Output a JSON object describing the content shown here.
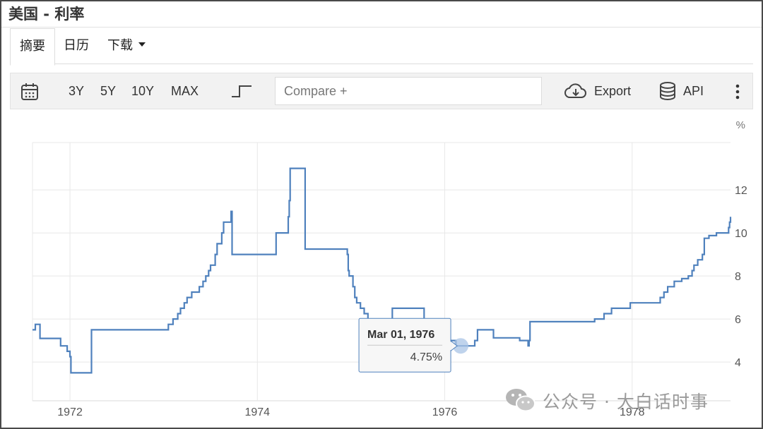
{
  "page": {
    "title": "美国 - 利率"
  },
  "tabs": [
    {
      "label": "摘要",
      "active": true
    },
    {
      "label": "日历",
      "active": false
    },
    {
      "label": "下载",
      "active": false
    }
  ],
  "toolbar": {
    "ranges": [
      "3Y",
      "5Y",
      "10Y",
      "MAX"
    ],
    "compare_placeholder": "Compare +",
    "export_label": "Export",
    "api_label": "API"
  },
  "tooltip": {
    "date": "Mar 01, 1976",
    "value": "4.75%"
  },
  "watermark": {
    "text": "公众号 · 大白话时事"
  },
  "colors": {
    "line": "#4f81bd",
    "grid": "#e8e8e8",
    "axis_text": "#555555",
    "tooltip_border": "#4f81bd"
  },
  "chart_data": {
    "type": "line",
    "step": true,
    "unit": "%",
    "x_tick_labels": [
      "1972",
      "1974",
      "1976",
      "1978"
    ],
    "x_ticks": [
      1972.0,
      1974.0,
      1976.0,
      1978.0
    ],
    "y_ticks": [
      4,
      6,
      8,
      10,
      12
    ],
    "xlim": [
      1971.6,
      1979.05
    ],
    "ylim": [
      2.2,
      14.2
    ],
    "grid": true,
    "highlight": {
      "x": 1976.17,
      "y": 4.75
    },
    "series": [
      {
        "values": [
          [
            1971.6,
            5.5
          ],
          [
            1971.63,
            5.75
          ],
          [
            1971.67,
            5.75
          ],
          [
            1971.68,
            5.1
          ],
          [
            1971.88,
            5.1
          ],
          [
            1971.9,
            4.75
          ],
          [
            1971.95,
            4.75
          ],
          [
            1971.97,
            4.5
          ],
          [
            1971.99,
            4.5
          ],
          [
            1972.0,
            4.25
          ],
          [
            1972.01,
            3.5
          ],
          [
            1972.22,
            3.5
          ],
          [
            1972.23,
            5.5
          ],
          [
            1973.02,
            5.5
          ],
          [
            1973.05,
            5.75
          ],
          [
            1973.1,
            6.0
          ],
          [
            1973.15,
            6.25
          ],
          [
            1973.18,
            6.5
          ],
          [
            1973.22,
            6.75
          ],
          [
            1973.25,
            7.0
          ],
          [
            1973.3,
            7.25
          ],
          [
            1973.38,
            7.5
          ],
          [
            1973.42,
            7.75
          ],
          [
            1973.45,
            8.0
          ],
          [
            1973.48,
            8.25
          ],
          [
            1973.5,
            8.5
          ],
          [
            1973.55,
            9.0
          ],
          [
            1973.57,
            9.5
          ],
          [
            1973.62,
            10.0
          ],
          [
            1973.64,
            10.5
          ],
          [
            1973.7,
            10.5
          ],
          [
            1973.72,
            11.0
          ],
          [
            1973.73,
            9.0
          ],
          [
            1974.17,
            9.0
          ],
          [
            1974.2,
            10.0
          ],
          [
            1974.32,
            10.0
          ],
          [
            1974.33,
            10.75
          ],
          [
            1974.34,
            11.5
          ],
          [
            1974.35,
            13.0
          ],
          [
            1974.5,
            13.0
          ],
          [
            1974.51,
            9.25
          ],
          [
            1974.94,
            9.25
          ],
          [
            1974.96,
            9.0
          ],
          [
            1974.97,
            8.25
          ],
          [
            1974.98,
            8.0
          ],
          [
            1975.02,
            7.5
          ],
          [
            1975.04,
            7.0
          ],
          [
            1975.06,
            6.75
          ],
          [
            1975.1,
            6.5
          ],
          [
            1975.14,
            6.25
          ],
          [
            1975.18,
            6.0
          ],
          [
            1975.26,
            5.5
          ],
          [
            1975.43,
            5.5
          ],
          [
            1975.44,
            6.5
          ],
          [
            1975.77,
            6.5
          ],
          [
            1975.78,
            6.0
          ],
          [
            1975.93,
            5.75
          ],
          [
            1975.97,
            5.25
          ],
          [
            1976.02,
            5.0
          ],
          [
            1976.12,
            4.75
          ],
          [
            1976.29,
            4.75
          ],
          [
            1976.32,
            5.0
          ],
          [
            1976.35,
            5.5
          ],
          [
            1976.5,
            5.5
          ],
          [
            1976.52,
            5.125
          ],
          [
            1976.78,
            5.125
          ],
          [
            1976.8,
            5.0
          ],
          [
            1976.88,
            5.0
          ],
          [
            1976.89,
            4.75
          ],
          [
            1976.9,
            5.0
          ],
          [
            1976.91,
            5.875
          ],
          [
            1977.55,
            5.875
          ],
          [
            1977.6,
            6.0
          ],
          [
            1977.7,
            6.25
          ],
          [
            1977.78,
            6.5
          ],
          [
            1977.96,
            6.5
          ],
          [
            1977.98,
            6.75
          ],
          [
            1978.27,
            6.75
          ],
          [
            1978.3,
            7.0
          ],
          [
            1978.34,
            7.25
          ],
          [
            1978.38,
            7.5
          ],
          [
            1978.45,
            7.75
          ],
          [
            1978.53,
            7.875
          ],
          [
            1978.6,
            8.0
          ],
          [
            1978.64,
            8.25
          ],
          [
            1978.66,
            8.5
          ],
          [
            1978.7,
            8.75
          ],
          [
            1978.75,
            9.0
          ],
          [
            1978.77,
            9.75
          ],
          [
            1978.82,
            9.875
          ],
          [
            1978.9,
            10.0
          ],
          [
            1978.99,
            10.0
          ],
          [
            1979.03,
            10.25
          ],
          [
            1979.04,
            10.5
          ],
          [
            1979.05,
            10.75
          ]
        ]
      }
    ]
  }
}
